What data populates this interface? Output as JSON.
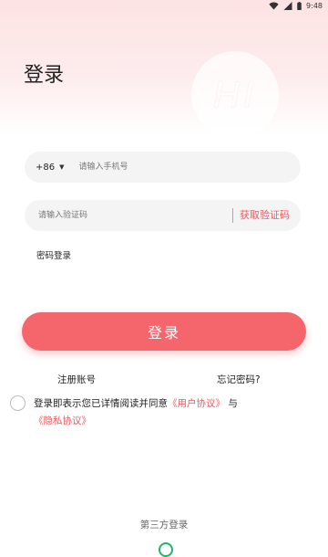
{
  "status_bar": {
    "time": "9:48",
    "icons": [
      "wifi-icon",
      "signal-icon",
      "battery-icon"
    ]
  },
  "header": {
    "title": "登录",
    "decoration_text": "HI"
  },
  "phone_field": {
    "country_code": "+86",
    "country_caret_icon": "chevron-down-icon",
    "placeholder": "请输入手机号",
    "value": ""
  },
  "code_field": {
    "placeholder": "请输入验证码",
    "value": "",
    "get_code_label": "获取验证码"
  },
  "password_login_label": "密码登录",
  "login_button_label": "登录",
  "register_label": "注册账号",
  "forgot_password_label": "忘记密码?",
  "agreement": {
    "checked": false,
    "prefix": "登录即表示您已详情阅读并同意",
    "user_agreement": "《用户协议》",
    "conjunction": "与",
    "privacy_policy": "《隐私协议》"
  },
  "third_party": {
    "label": "第三方登录",
    "icons": [
      "wechat-icon"
    ]
  },
  "colors": {
    "accent": "#f4666c",
    "link": "#ef5a61",
    "field_background": "#f4f4f4",
    "header_tint": "#fde3e3",
    "third_party_green": "#22b36a"
  }
}
